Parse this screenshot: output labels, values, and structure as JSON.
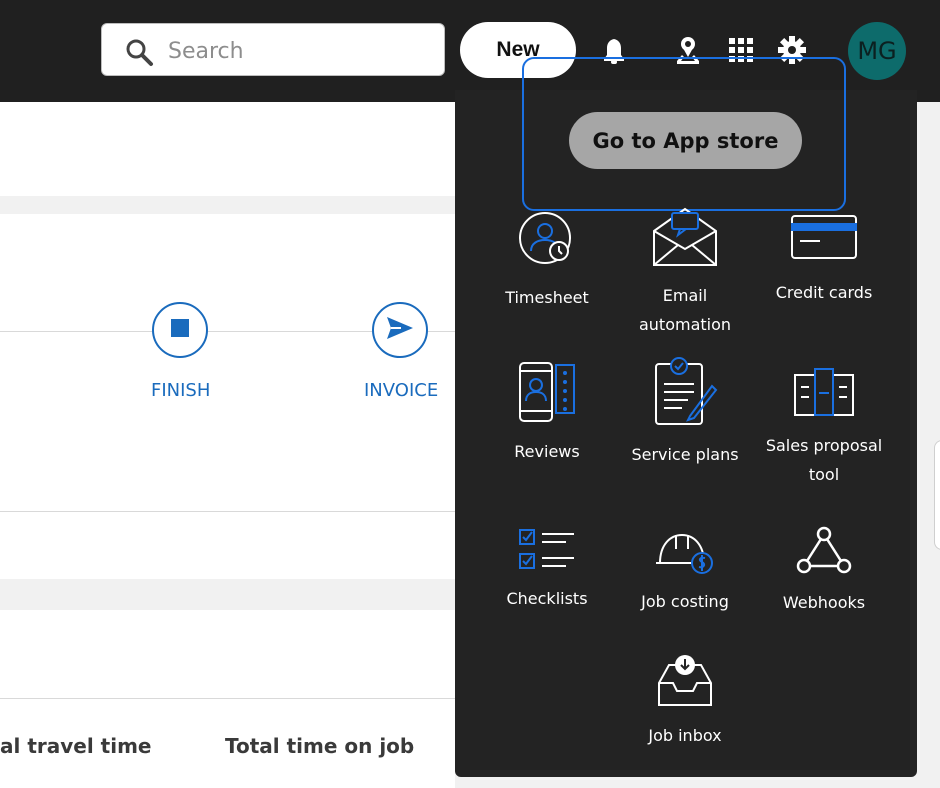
{
  "header": {
    "search_placeholder": "Search",
    "new_label": "New",
    "avatar_initials": "MG"
  },
  "job_progress": {
    "steps": [
      {
        "label": "FINISH"
      },
      {
        "label": "INVOICE"
      }
    ]
  },
  "stats": {
    "travel_time_label": "al travel time",
    "time_on_job_label": "Total time on job"
  },
  "apps_menu": {
    "app_store_button": "Go to App store",
    "items": [
      {
        "label": "Timesheet"
      },
      {
        "label": "Email automation"
      },
      {
        "label": "Credit cards"
      },
      {
        "label": "Reviews"
      },
      {
        "label": "Service plans"
      },
      {
        "label": "Sales proposal tool"
      },
      {
        "label": "Checklists"
      },
      {
        "label": "Job costing"
      },
      {
        "label": "Webhooks"
      },
      {
        "label": "Job inbox"
      }
    ]
  },
  "colors": {
    "topbar": "#202020",
    "accent_blue": "#1a6bbd",
    "avatar": "#0d6b6b",
    "dropdown": "#232323",
    "highlight": "#1a6fe0"
  }
}
